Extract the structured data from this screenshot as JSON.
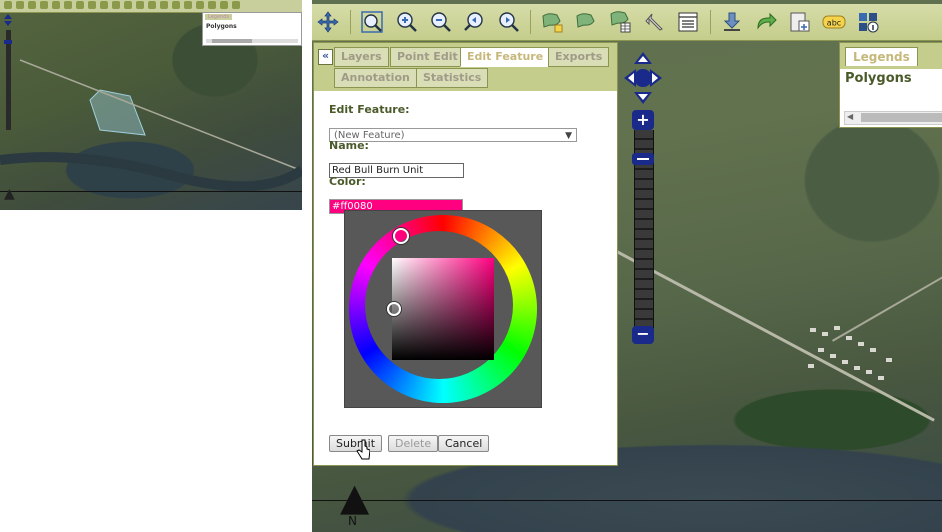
{
  "thumbnail": {
    "legend_tab": "Legends",
    "legend_title": "Polygons"
  },
  "toolbar": {
    "tools": [
      "pan-icon",
      "zoom-extent-icon",
      "zoom-in-icon",
      "zoom-out-icon",
      "zoom-previous-icon",
      "zoom-next-icon",
      "draw-polygon-icon",
      "edit-polygon-icon",
      "polygon-table-icon",
      "select-arrow-icon",
      "attribute-table-icon",
      "download-icon",
      "redo-icon",
      "export-map-icon",
      "label-icon",
      "identify-icon"
    ],
    "label_tool_text": "abc"
  },
  "zoom": {
    "in_label": "+",
    "out_label": "−"
  },
  "legend": {
    "tab": "Legends",
    "title": "Polygons"
  },
  "panel": {
    "collapse": "«",
    "tabs_row1": [
      "Layers",
      "Point Edit",
      "Edit Feature",
      "Exports"
    ],
    "tabs_row2": [
      "Annotation",
      "Statistics"
    ],
    "active_tab": "Edit Feature",
    "edit_feature_label": "Edit Feature:",
    "feature_select_value": "(New Feature)",
    "name_label": "Name:",
    "name_value": "Red Bull Burn Unit",
    "color_label": "Color:",
    "color_value": "#ff0080",
    "buttons": {
      "submit": "Submit",
      "delete": "Delete",
      "cancel": "Cancel"
    }
  },
  "colors": {
    "selected": "#ff0080",
    "toolbar": "#c5cd8c",
    "accent_text": "#4a5a2a",
    "zoom_blue": "#1a2a8a"
  }
}
